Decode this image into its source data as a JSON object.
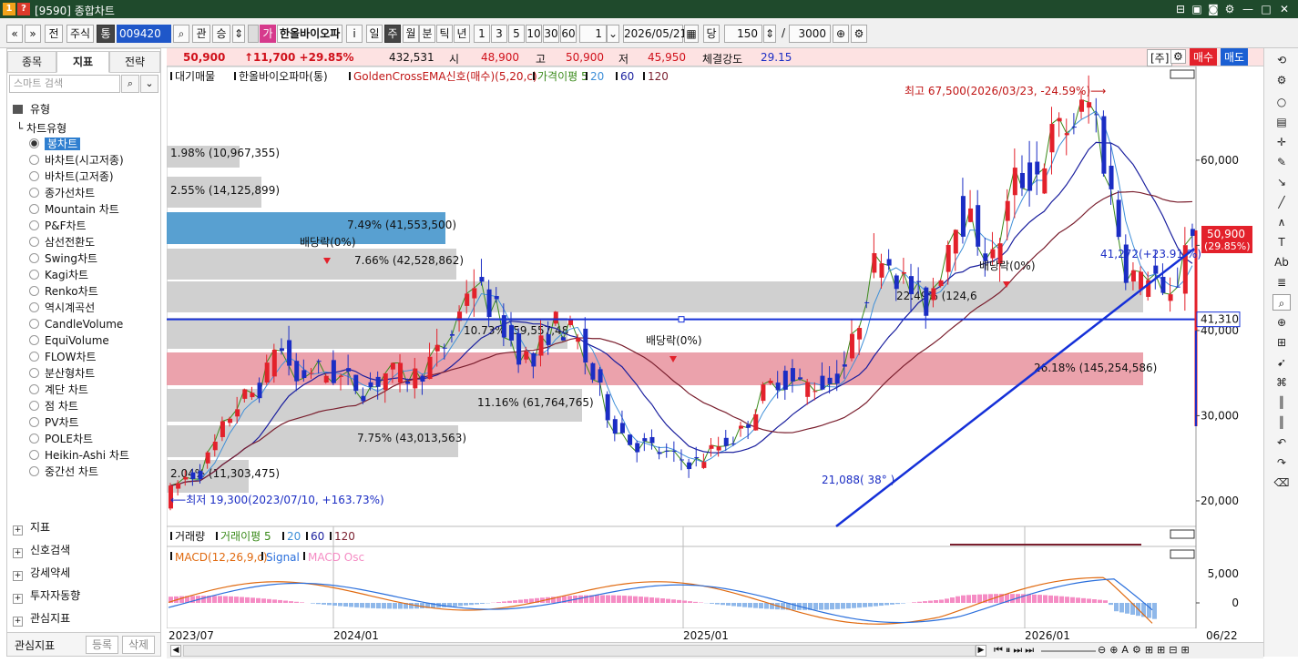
{
  "window": {
    "title": "[9590] 종합차트",
    "icon_label": "1",
    "help_label": "?"
  },
  "toolbar": {
    "nav_prev": "«",
    "nav_down": "»",
    "btn_jeon": "전",
    "market": "주식",
    "tong": "통",
    "code": "009420",
    "gwan": "관",
    "seung": "승",
    "ga": "가",
    "stock_name": "한올바이오파",
    "info": "i",
    "periods": [
      "일",
      "주",
      "월",
      "분",
      "틱",
      "년"
    ],
    "period_selected": "주",
    "nums": [
      "1",
      "3",
      "5",
      "10",
      "30",
      "60"
    ],
    "unit_value": "1",
    "date": "2026/05/21",
    "dang": "당",
    "count": "150",
    "slash": "/",
    "max_count": "3000"
  },
  "quote": {
    "price": "50,900",
    "change": "↑11,700 +29.85%",
    "volume": "432,531",
    "open_label": "시",
    "open": "48,900",
    "high_label": "고",
    "high": "50,900",
    "low_label": "저",
    "low": "45,950",
    "strength_label": "체결강도",
    "strength": "29.15",
    "ju": "[주]",
    "buy": "매수",
    "sell": "매도"
  },
  "sidebar": {
    "tabs": [
      "종목",
      "지표",
      "전략"
    ],
    "active_tab": "지표",
    "search_placeholder": "스마트 검색",
    "section_type": "유형",
    "subsection": "차트유형",
    "chart_types": [
      "봉차트",
      "바차트(시고저종)",
      "바차트(고저종)",
      "종가선차트",
      "Mountain 차트",
      "P&F차트",
      "삼선전환도",
      "Swing차트",
      "Kagi차트",
      "Renko차트",
      "역시계곡선",
      "CandleVolume",
      "EquiVolume",
      "FLOW차트",
      "분산형차트",
      "계단 차트",
      "점 차트",
      "PV차트",
      "POLE차트",
      "Heikin-Ashi 차트",
      "중간선 차트"
    ],
    "selected_type": "봉차트",
    "folders": [
      "지표",
      "신호검색",
      "강세약세",
      "투자자동향",
      "관심지표"
    ],
    "favorites_label": "관심지표",
    "register": "등록",
    "delete": "삭제"
  },
  "legend": {
    "main": [
      "대기매물",
      "한올바이오파마(통)",
      "GoldenCrossEMA신호(매수)(5,20,c)",
      "가격이평 5",
      "20",
      "60",
      "120"
    ],
    "volume": [
      "거래량",
      "거래이평 5",
      "20",
      "60",
      "120"
    ],
    "macd": [
      "MACD(12,26,9,c)",
      "Signal",
      "MACD Osc"
    ]
  },
  "colors": {
    "up": "#e3212b",
    "down": "#1b2dc4",
    "ma5": "#3a8a1a",
    "ma20": "#3e8fd8",
    "ma60": "#1a1f9e",
    "ma120": "#7a1f2e",
    "trend": "#1530d8",
    "vp_gray": "#c8c8c8",
    "vp_blue": "#3b8fc9",
    "vp_pink": "#e8929e",
    "macd": "#e06a10",
    "signal": "#2a6fdc",
    "osc_pos": "#f58cc4",
    "osc_neg": "#8fb8ea"
  },
  "annotations": {
    "high": "최고 67,500(2026/03/23, -24.59%)⟶",
    "low": "⟵최저 19,300(2023/07/10, +163.73%)",
    "dividend": "배당락(0%)",
    "trend_label": "21,088( 38° )",
    "trend_label2": "41,272(+23.91 %)",
    "hline": "41,310",
    "price_tag": "50,900",
    "price_tag_pct": "(29.85%)"
  },
  "volume_profile": [
    {
      "label": "1.98% (10,967,355)"
    },
    {
      "label": "2.55% (14,125,899)"
    },
    {
      "label": "7.49% (41,553,500)"
    },
    {
      "label": "7.66% (42,528,862)"
    },
    {
      "label": "22.49% (124,6"
    },
    {
      "label": "10.73% (59,557,48"
    },
    {
      "label": "26.18% (145,254,586)"
    },
    {
      "label": "11.16% (61,764,765)"
    },
    {
      "label": "7.75% (43,013,563)"
    },
    {
      "label": "2.04% (11,303,475)"
    }
  ],
  "axes": {
    "y_ticks": [
      "60,000",
      "50,000",
      "40,000",
      "30,000",
      "20,000"
    ],
    "macd_ticks": [
      "5,000",
      "0"
    ],
    "x_ticks": [
      "2023/07",
      "2024/01",
      "2025/01",
      "2026/01",
      "06/22"
    ]
  },
  "chart_data": {
    "type": "candlestick",
    "title": "한올바이오파마(통)",
    "y_range": [
      17000,
      71000
    ],
    "price_ticks": [
      60000,
      50000,
      40000,
      30000,
      20000
    ],
    "last_close": 50900,
    "high": 67500,
    "low": 19300,
    "hline": 41310,
    "moving_averages": [
      5,
      20,
      60,
      120
    ]
  }
}
